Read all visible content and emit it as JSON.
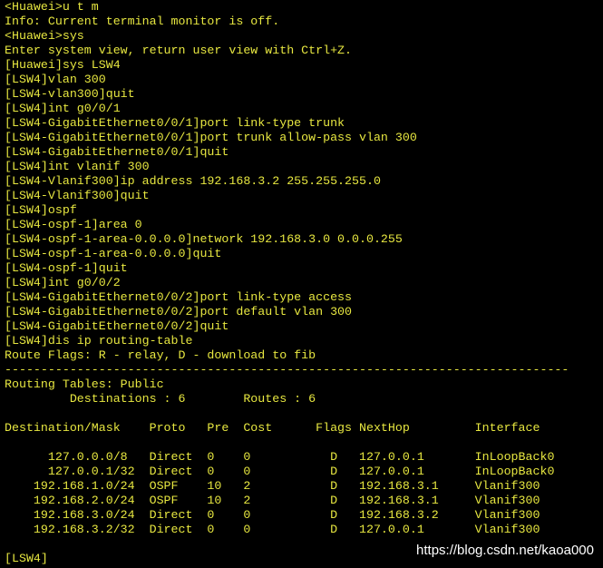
{
  "terminal": {
    "lines": [
      "<Huawei>u t m",
      "Info: Current terminal monitor is off.",
      "<Huawei>sys",
      "Enter system view, return user view with Ctrl+Z.",
      "[Huawei]sys LSW4",
      "[LSW4]vlan 300",
      "[LSW4-vlan300]quit",
      "[LSW4]int g0/0/1",
      "[LSW4-GigabitEthernet0/0/1]port link-type trunk",
      "[LSW4-GigabitEthernet0/0/1]port trunk allow-pass vlan 300",
      "[LSW4-GigabitEthernet0/0/1]quit",
      "[LSW4]int vlanif 300",
      "[LSW4-Vlanif300]ip address 192.168.3.2 255.255.255.0",
      "[LSW4-Vlanif300]quit",
      "[LSW4]ospf",
      "[LSW4-ospf-1]area 0",
      "[LSW4-ospf-1-area-0.0.0.0]network 192.168.3.0 0.0.0.255",
      "[LSW4-ospf-1-area-0.0.0.0]quit",
      "[LSW4-ospf-1]quit",
      "[LSW4]int g0/0/2",
      "[LSW4-GigabitEthernet0/0/2]port link-type access",
      "[LSW4-GigabitEthernet0/0/2]port default vlan 300",
      "[LSW4-GigabitEthernet0/0/2]quit",
      "[LSW4]dis ip routing-table",
      "Route Flags: R - relay, D - download to fib",
      "------------------------------------------------------------------------------",
      "Routing Tables: Public",
      "         Destinations : 6        Routes : 6",
      "",
      "Destination/Mask    Proto   Pre  Cost      Flags NextHop         Interface",
      "",
      "      127.0.0.0/8   Direct  0    0           D   127.0.0.1       InLoopBack0",
      "      127.0.0.1/32  Direct  0    0           D   127.0.0.1       InLoopBack0",
      "    192.168.1.0/24  OSPF    10   2           D   192.168.3.1     Vlanif300",
      "    192.168.2.0/24  OSPF    10   2           D   192.168.3.1     Vlanif300",
      "    192.168.3.0/24  Direct  0    0           D   192.168.3.2     Vlanif300",
      "    192.168.3.2/32  Direct  0    0           D   127.0.0.1       Vlanif300",
      "",
      "[LSW4]"
    ]
  },
  "watermark": {
    "text": "https://blog.csdn.net/kaoa000"
  },
  "colors": {
    "background": "#000000",
    "text": "#e7e740",
    "watermark": "#ffffff"
  }
}
